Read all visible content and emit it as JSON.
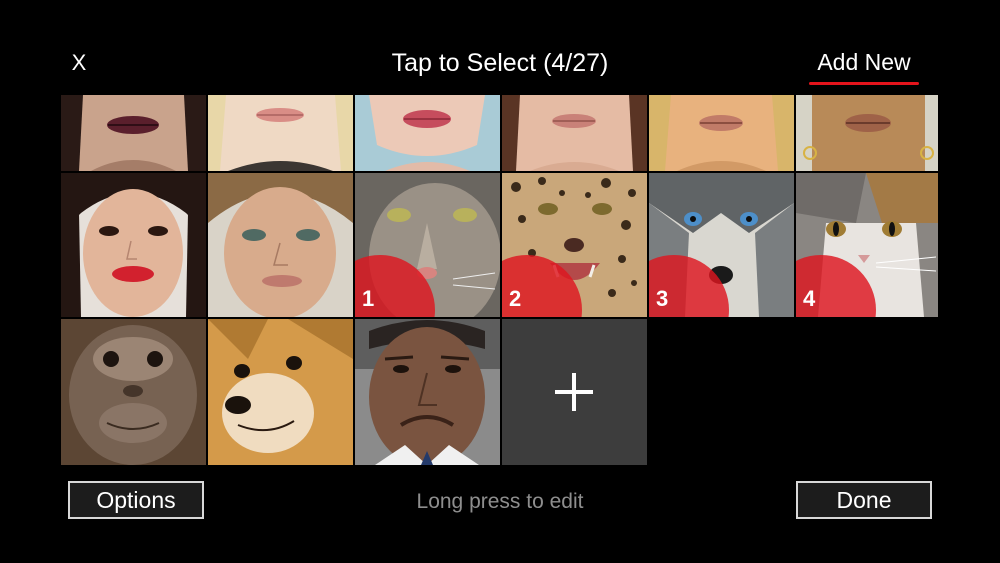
{
  "header": {
    "close_label": "X",
    "title": "Tap to Select (4/27)",
    "add_new_label": "Add New",
    "accent_color": "#e4141c"
  },
  "grid": {
    "mouth_tiles": [
      {
        "subject": "mouth-dark-lipstick"
      },
      {
        "subject": "mouth-blonde"
      },
      {
        "subject": "mouth-pink-lips"
      },
      {
        "subject": "mouth-brunette"
      },
      {
        "subject": "mouth-blonde-curly"
      },
      {
        "subject": "mouth-earrings"
      }
    ],
    "face_tiles": [
      {
        "subject": "face-red-lipstick",
        "badge": ""
      },
      {
        "subject": "face-green-eyes",
        "badge": ""
      },
      {
        "subject": "cougar",
        "badge": "1"
      },
      {
        "subject": "leopard",
        "badge": "2"
      },
      {
        "subject": "husky",
        "badge": "3"
      },
      {
        "subject": "cat",
        "badge": "4"
      }
    ],
    "bottom_tiles": [
      {
        "subject": "orangutan"
      },
      {
        "subject": "shiba-inu"
      },
      {
        "subject": "man-grimace"
      }
    ],
    "add_tile_icon": "plus-icon"
  },
  "footer": {
    "options_label": "Options",
    "hint": "Long press to edit",
    "done_label": "Done"
  }
}
